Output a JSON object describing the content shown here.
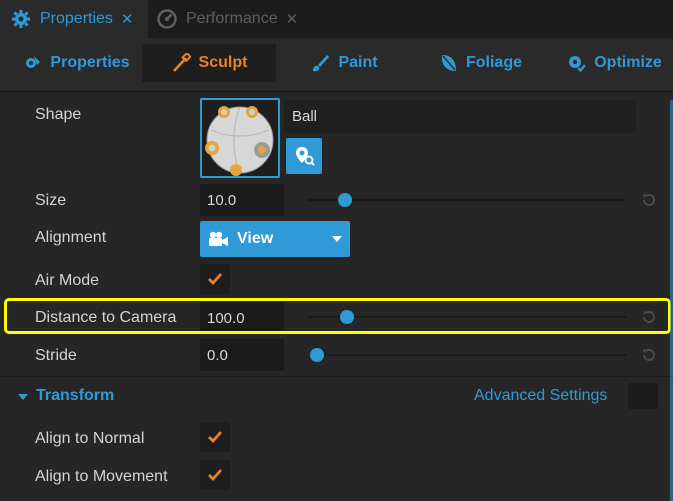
{
  "tabs": [
    {
      "label": "Properties",
      "icon": "gear-icon",
      "active": true,
      "close": "✕"
    },
    {
      "label": "Performance",
      "icon": "speedometer-icon",
      "active": false,
      "close": "✕"
    }
  ],
  "modes": [
    {
      "label": "Properties",
      "icon": "gear-brush-icon",
      "selected": false
    },
    {
      "label": "Sculpt",
      "icon": "sculpt-brush-icon",
      "selected": true
    },
    {
      "label": "Paint",
      "icon": "paint-brush-icon",
      "selected": false
    },
    {
      "label": "Foliage",
      "icon": "leaf-icon",
      "selected": false
    },
    {
      "label": "Optimize",
      "icon": "gear-check-icon",
      "selected": false
    }
  ],
  "shape": {
    "label": "Shape",
    "value": "Ball"
  },
  "size": {
    "label": "Size",
    "value": "10.0",
    "slider_fraction": 0.12
  },
  "alignment": {
    "label": "Alignment",
    "value": "View",
    "icon": "camera-icon"
  },
  "air_mode": {
    "label": "Air Mode",
    "checked": true
  },
  "distance": {
    "label": "Distance to Camera",
    "value": "100.0",
    "slider_fraction": 0.13
  },
  "stride": {
    "label": "Stride",
    "value": "0.0",
    "slider_fraction": 0.0
  },
  "transform": {
    "title": "Transform",
    "advanced_label": "Advanced Settings",
    "advanced_checked": false,
    "align_normal": {
      "label": "Align to Normal",
      "checked": true
    },
    "align_movement": {
      "label": "Align to Movement",
      "checked": true
    }
  },
  "colors": {
    "accent": "#2f9ad6",
    "orange": "#e8832a",
    "highlight": "#ffff00",
    "background": "#262626"
  }
}
